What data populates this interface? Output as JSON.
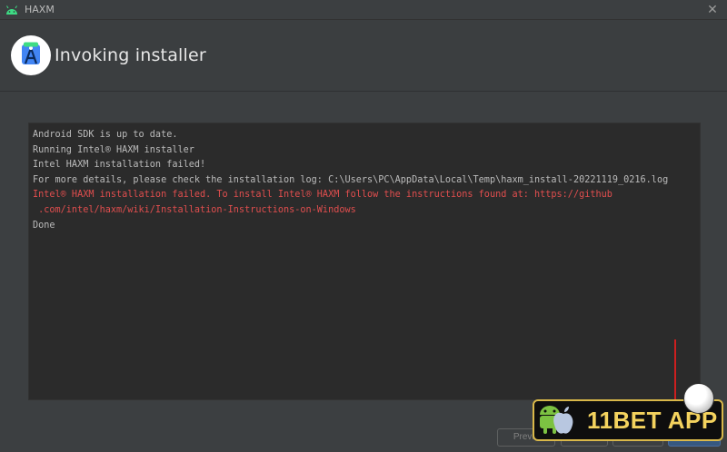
{
  "window": {
    "title": "HAXM"
  },
  "header": {
    "title": "Invoking installer"
  },
  "console": {
    "lines": [
      {
        "text": "Android SDK is up to date.",
        "level": "info"
      },
      {
        "text": "Running Intel® HAXM installer",
        "level": "info"
      },
      {
        "text": "Intel HAXM installation failed!",
        "level": "info"
      },
      {
        "text": "For more details, please check the installation log: C:\\Users\\PC\\AppData\\Local\\Temp\\haxm_install-20221119_0216.log",
        "level": "info"
      },
      {
        "text": "Intel® HAXM installation failed. To install Intel® HAXM follow the instructions found at: https://github",
        "level": "error"
      },
      {
        "text": " .com/intel/haxm/wiki/Installation-Instructions-on-Windows",
        "level": "error"
      },
      {
        "text": "Done",
        "level": "info"
      }
    ]
  },
  "footer": {
    "previous_label": "Previo"
  },
  "watermark": {
    "text": "11BET APP"
  },
  "colors": {
    "error": "#e04e4e",
    "text": "#bbbbbb",
    "background": "#2b2b2b"
  }
}
